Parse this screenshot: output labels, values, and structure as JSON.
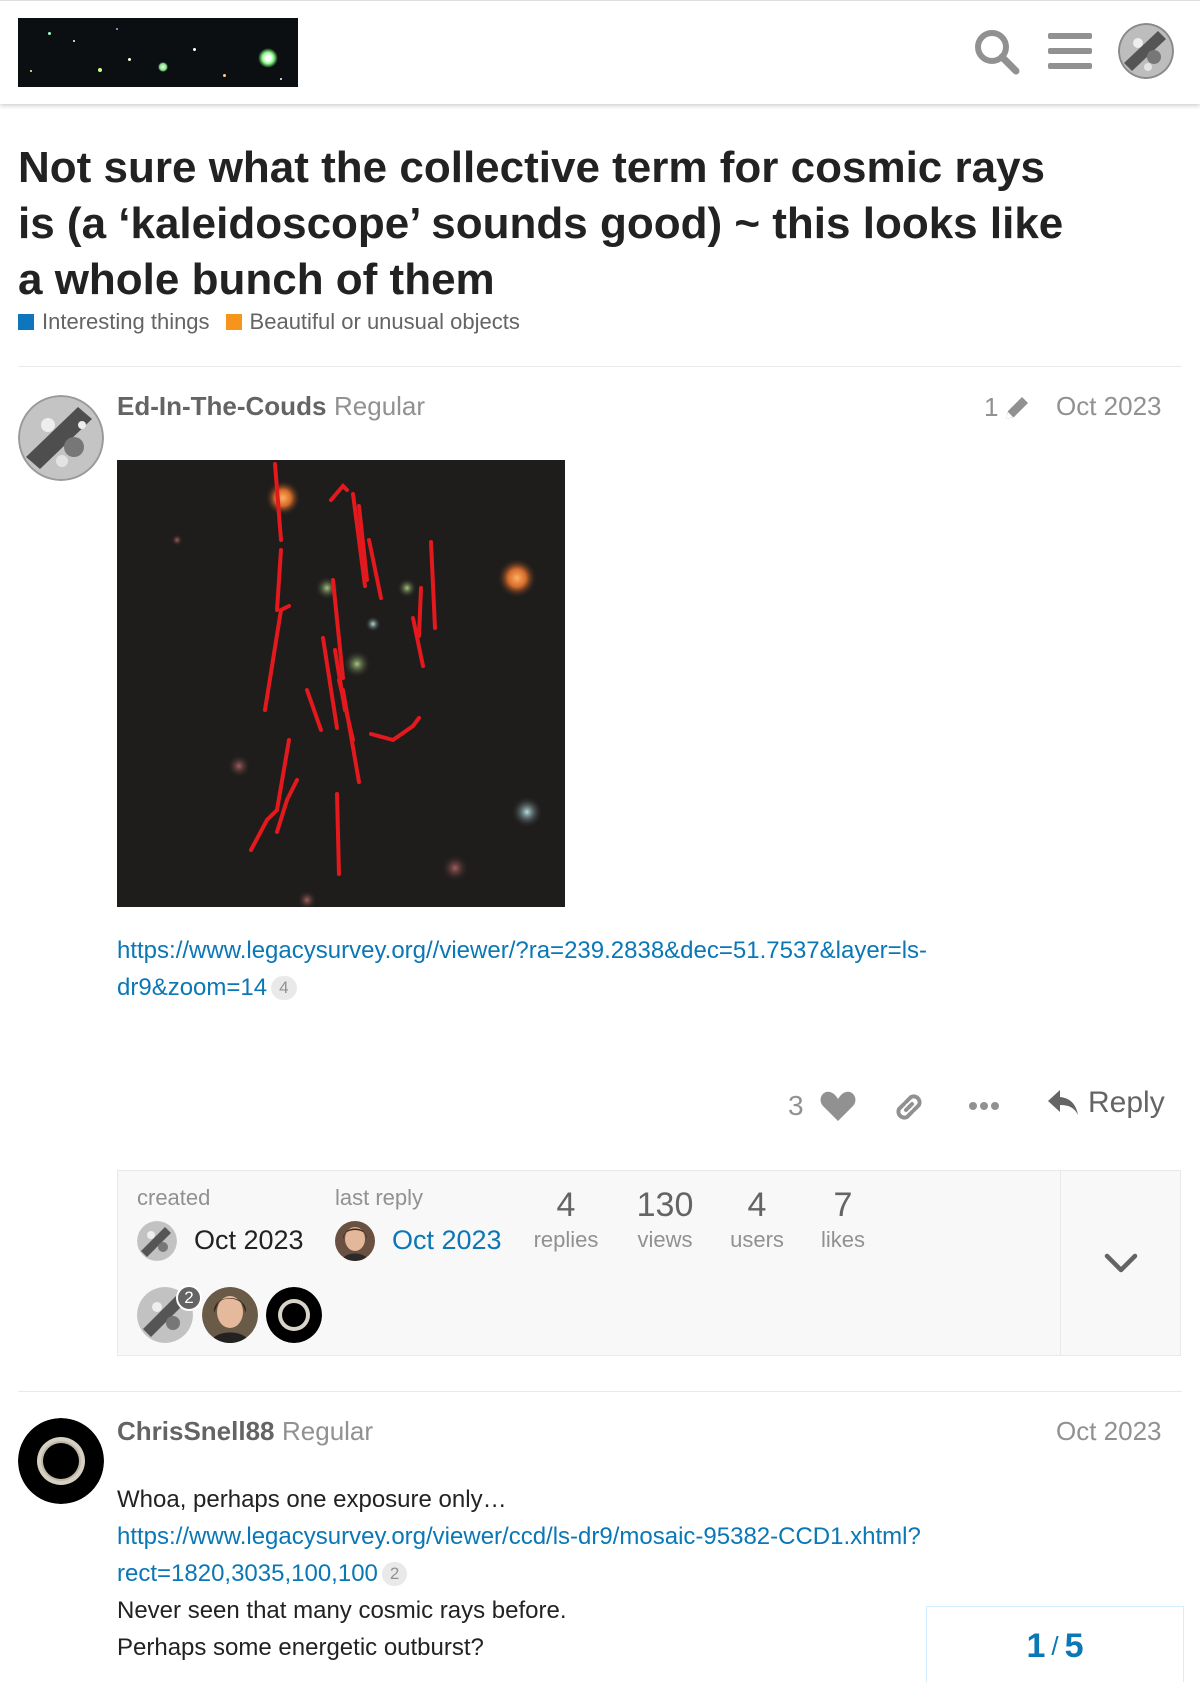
{
  "header": {
    "logo_icon": "starfield-logo",
    "search_icon": "search-icon",
    "menu_icon": "hamburger-menu-icon",
    "avatar_icon": "user-avatar"
  },
  "topic": {
    "title": "Not sure what the collective term for cosmic rays is (a ‘kaleidoscope’ sounds good) ~ this looks like a whole bunch of them",
    "categories": [
      {
        "name": "Interesting things",
        "color": "#0e76bd"
      },
      {
        "name": "Beautiful or unusual objects",
        "color": "#f7941d"
      }
    ]
  },
  "posts": [
    {
      "username": "Ed-In-The-Couds",
      "user_title": "Regular",
      "edit_count": "1",
      "date": "Oct 2023",
      "link_line1": "https://www.legacysurvey.org//viewer/?ra=239.2838&dec=51.7537&layer=ls-",
      "link_line2": "dr9&zoom=14",
      "link_clicks": "4",
      "likes": "3",
      "reply_label": "Reply"
    },
    {
      "username": "ChrisSnell88",
      "user_title": "Regular",
      "date": "Oct 2023",
      "text1": "Whoa, perhaps one exposure only…",
      "link_line1": "https://www.legacysurvey.org/viewer/ccd/ls-dr9/mosaic-95382-CCD1.xhtml?",
      "link_line2": "rect=1820,3035,100,100",
      "link_clicks": "2",
      "text2": "Never seen that many cosmic rays before.",
      "text3": "Perhaps some energetic outburst?"
    }
  ],
  "topic_map": {
    "created_label": "created",
    "created_date": "Oct 2023",
    "last_reply_label": "last reply",
    "last_reply_date": "Oct 2023",
    "stats": [
      {
        "value": "4",
        "label": "replies"
      },
      {
        "value": "130",
        "label": "views"
      },
      {
        "value": "4",
        "label": "users"
      },
      {
        "value": "7",
        "label": "likes"
      }
    ],
    "participant_badge": "2"
  },
  "progress": {
    "current": "1",
    "separator": "/",
    "total": "5"
  },
  "colors": {
    "link": "#0a77b6",
    "muted": "#919191",
    "accent_like": "#919191"
  }
}
